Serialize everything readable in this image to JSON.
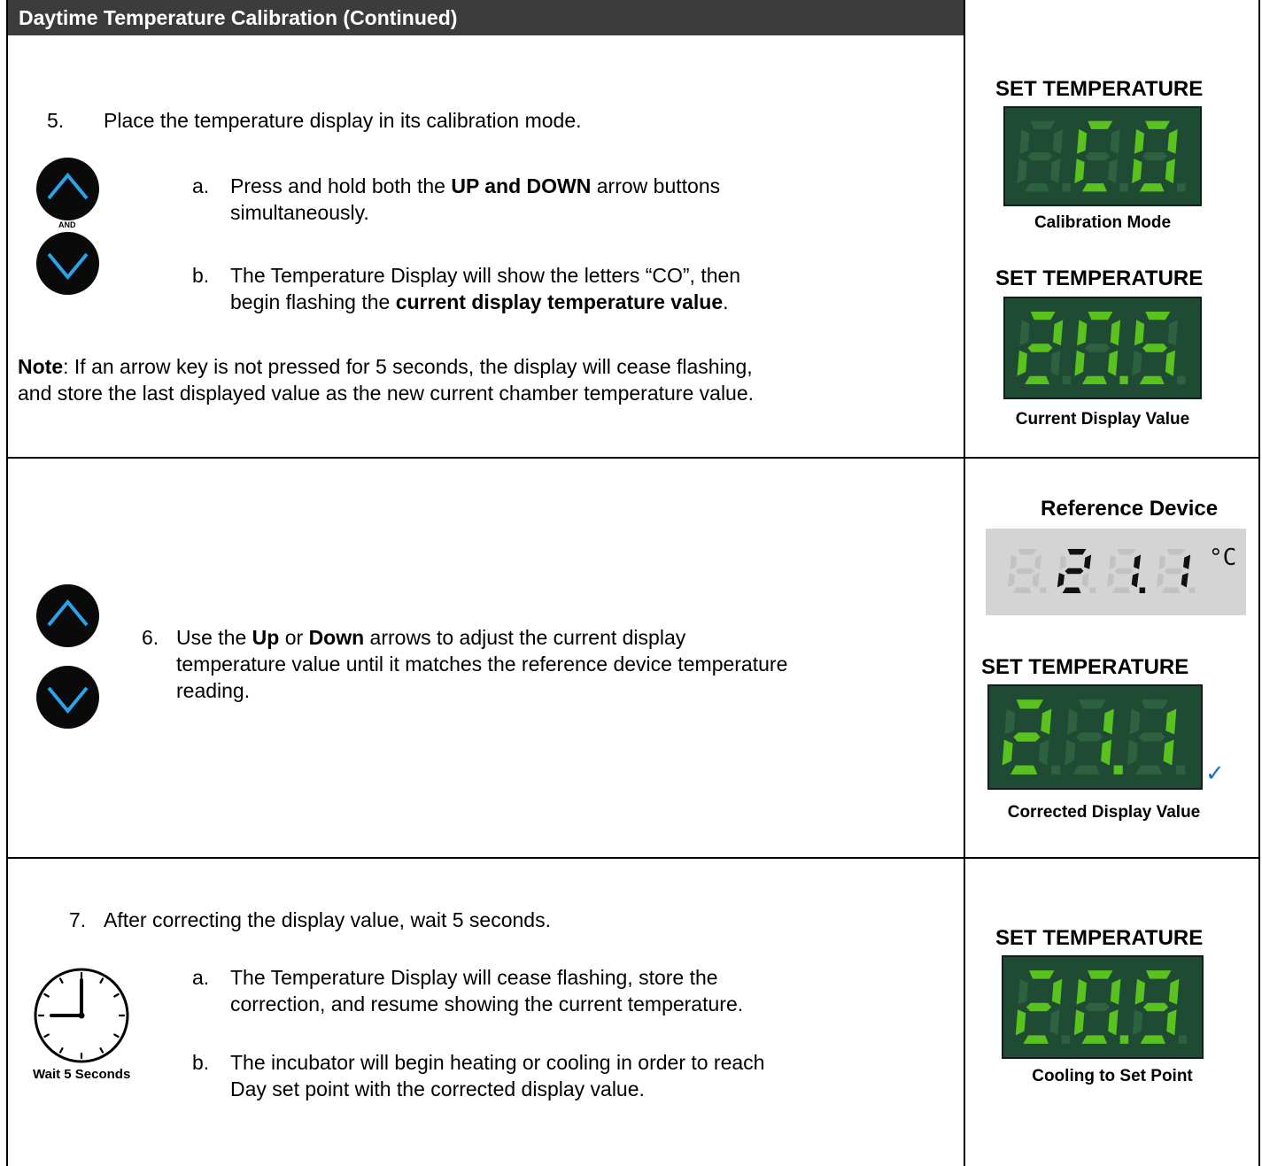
{
  "header": {
    "title": "Daytime Temperature Calibration (Continued)"
  },
  "section5": {
    "number": "5.",
    "text": "Place the temperature display in its calibration mode.",
    "and_label": "AND",
    "a_marker": "a.",
    "a_pre": "Press and hold both the ",
    "a_bold": "UP and DOWN",
    "a_post": " arrow buttons",
    "a_line2": "simultaneously.",
    "b_marker": "b.",
    "b_line1": "The Temperature Display will show the letters “CO”, then",
    "b_pre": "begin flashing the ",
    "b_bold": "current display temperature value",
    "b_post": ".",
    "note_label": "Note",
    "note_line1": ": If an arrow key is not pressed for 5 seconds, the display will cease flashing,",
    "note_line2": "and store the last displayed value as the new current chamber temperature value.",
    "display1_title": "SET TEMPERATURE",
    "display1_caption": "Calibration Mode",
    "display2_title": "SET TEMPERATURE",
    "display2_caption": "Current Display Value"
  },
  "section6": {
    "number": "6.",
    "pre1": "Use the ",
    "bold1": "Up",
    "mid1": " or ",
    "bold2": "Down",
    "post1": " arrows to adjust the current display",
    "line2": "temperature value until it matches the reference device temperature",
    "line3": "reading.",
    "reference_title": "Reference Device",
    "reference_unit": "°C",
    "display_title": "SET TEMPERATURE",
    "display_caption": "Corrected Display Value",
    "check_mark": "✓"
  },
  "section7": {
    "number": "7.",
    "text": "After correcting the display value, wait 5 seconds.",
    "clock_caption": "Wait 5 Seconds",
    "a_marker": "a.",
    "a_line1": "The Temperature Display will cease flashing, store the",
    "a_line2": "correction, and resume showing the current temperature.",
    "b_marker": "b.",
    "b_line1": "The incubator will begin heating or cooling in order to reach",
    "b_line2": "Day set point with the corrected display value.",
    "display_title": "SET TEMPERATURE",
    "display_caption": "Cooling to Set Point"
  },
  "displays": {
    "calibration": "CO",
    "current": "20.5",
    "reference": "21.1",
    "corrected": "21.1",
    "cooling": "20.9"
  },
  "colors": {
    "lcd_background": "#1f4a34",
    "lcd_segment_on": "#59c21f",
    "lcd_segment_off": "#2d6140",
    "header_background": "#3c3c3c",
    "arrow_button_icon": "#2aa3e8",
    "check_color": "#1b6fd1"
  }
}
